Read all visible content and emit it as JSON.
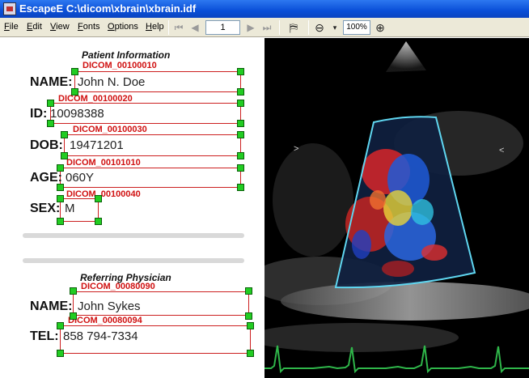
{
  "window": {
    "title": "EscapeE C:\\dicom\\xbrain\\xbrain.idf"
  },
  "menubar": {
    "items": [
      "File",
      "Edit",
      "View",
      "Fonts",
      "Options",
      "Help"
    ],
    "page": "1",
    "zoom": "100%"
  },
  "patient": {
    "header": "Patient Information",
    "fields": [
      {
        "label": "NAME:",
        "value": "John N. Doe",
        "tag": "DICOM_00100010"
      },
      {
        "label": "ID:",
        "value": "10098388",
        "tag": "DICOM_00100020"
      },
      {
        "label": "DOB:",
        "value": "19471201",
        "tag": "DICOM_00100030"
      },
      {
        "label": "AGE:",
        "value": "060Y",
        "tag": "DICOM_00101010"
      },
      {
        "label": "SEX:",
        "value": "M",
        "tag": "DICOM_00100040"
      }
    ]
  },
  "physician": {
    "header": "Referring Physician",
    "fields": [
      {
        "label": "NAME:",
        "value": "John Sykes",
        "tag": "DICOM_00080090"
      },
      {
        "label": "TEL:",
        "value": "858 794-7334",
        "tag": "DICOM_00080094"
      }
    ]
  },
  "image_labels": {
    "left_marker": ">",
    "right_marker": "<"
  },
  "colors": {
    "titlebar": "#0a4fd8",
    "tag_text": "#d01010",
    "handle": "#22cc22",
    "ecg": "#2fb64a",
    "sector_outline": "#5fd6f0"
  }
}
